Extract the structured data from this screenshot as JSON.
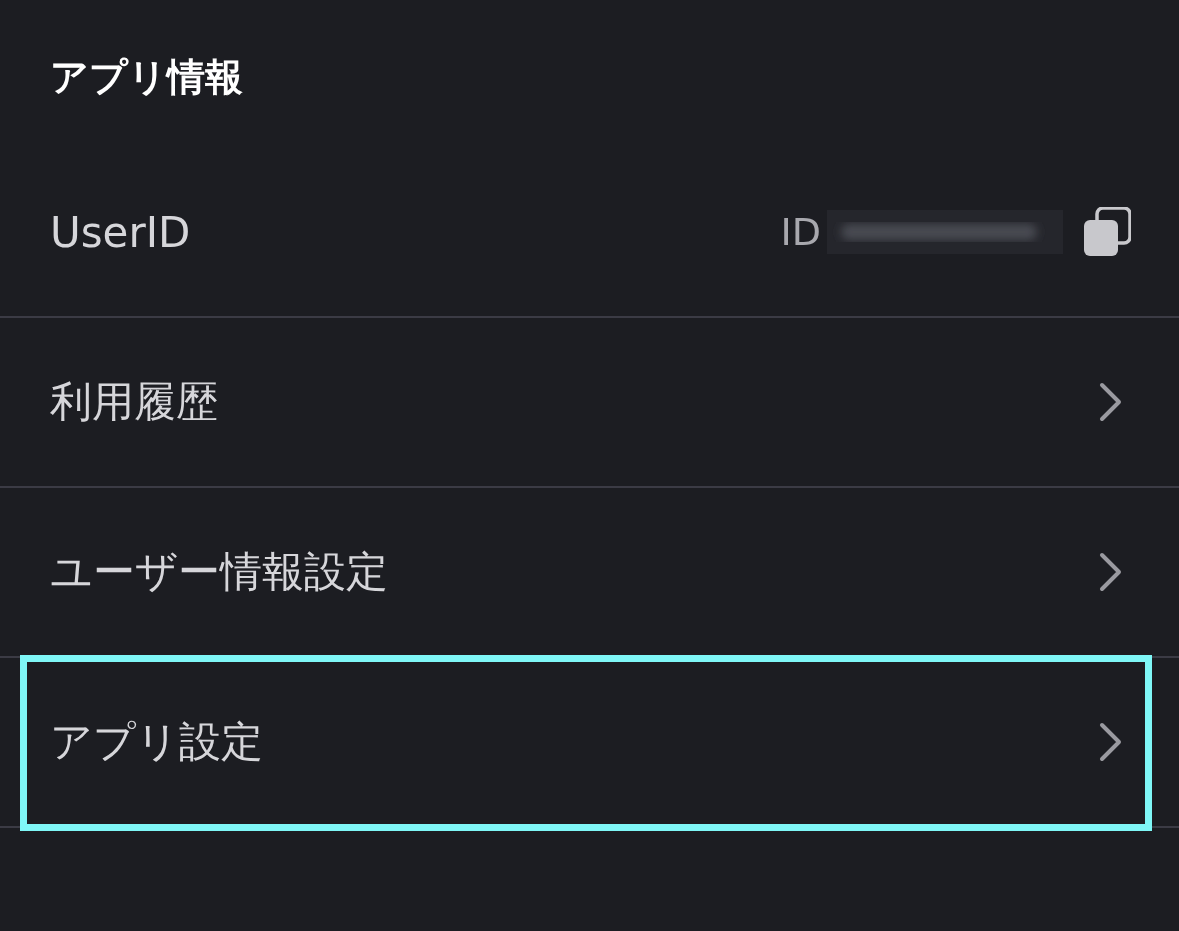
{
  "section_title": "アプリ情報",
  "rows": [
    {
      "kind": "id",
      "label": "UserID",
      "id_prefix": "ID",
      "highlighted": false
    },
    {
      "kind": "link",
      "label": "利用履歴",
      "highlighted": false
    },
    {
      "kind": "link",
      "label": "ユーザー情報設定",
      "highlighted": false
    },
    {
      "kind": "link",
      "label": "アプリ設定",
      "highlighted": true
    }
  ]
}
